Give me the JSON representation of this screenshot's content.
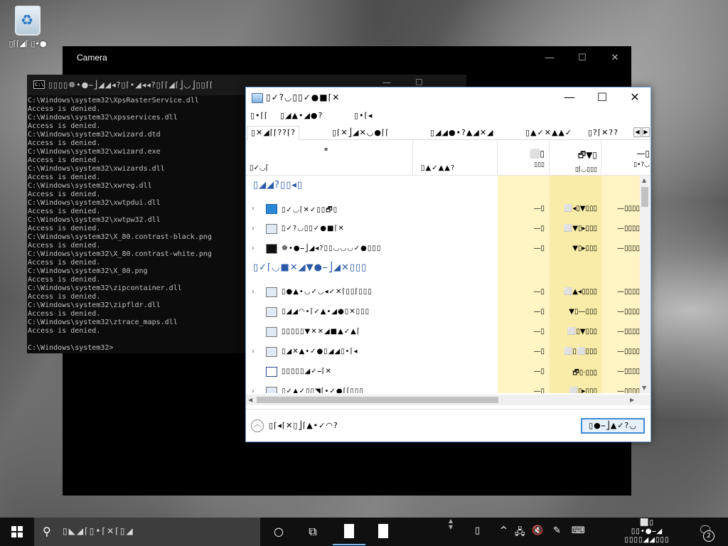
{
  "desktop": {
    "recycle_bin_label": "▯⌈⌈◢⌈ ▯•●"
  },
  "camera": {
    "title": "Camera",
    "minimize": "—",
    "maximize": "☐",
    "close": "✕"
  },
  "console": {
    "icon_text": "C:\\",
    "title": "▯▯▯▯☸•●⎯⎦◢◢◂?▯⌈•◢◂◂?▯⌈⌈◢⌈⎦◡⎦▯▯⌈⌈",
    "minimize": "—",
    "maximize": "☐",
    "lines": [
      "C:\\Windows\\system32\\XpsRasterService.dll",
      "Access is denied.",
      "C:\\Windows\\system32\\xpsservices.dll",
      "Access is denied.",
      "C:\\Windows\\system32\\xwizard.dtd",
      "Access is denied.",
      "C:\\Windows\\system32\\xwizard.exe",
      "Access is denied.",
      "C:\\Windows\\system32\\xwizards.dll",
      "Access is denied.",
      "C:\\Windows\\system32\\xwreg.dll",
      "Access is denied.",
      "C:\\Windows\\system32\\xwtpdui.dll",
      "Access is denied.",
      "C:\\Windows\\system32\\xwtpw32.dll",
      "Access is denied.",
      "C:\\Windows\\system32\\X_80.contrast-black.png",
      "Access is denied.",
      "C:\\Windows\\system32\\X_80.contrast-white.png",
      "Access is denied.",
      "C:\\Windows\\system32\\X_80.png",
      "Access is denied.",
      "C:\\Windows\\system32\\zipcontainer.dll",
      "Access is denied.",
      "C:\\Windows\\system32\\zipfldr.dll",
      "Access is denied.",
      "C:\\Windows\\system32\\ztrace_maps.dll",
      "Access is denied.",
      "",
      "C:\\Windows\\system32>"
    ]
  },
  "taskmgr": {
    "title": "▯✓?◡▯▯✓●■⌈✕",
    "minimize": "—",
    "maximize": "☐",
    "close": "✕",
    "menu": [
      "▯•⌈⌈",
      "▯◢▲•◢●?",
      "▯•⌈◂"
    ],
    "tabs": [
      "▯✕◢⌈⌈??⌈?",
      "▯⌈✕⎦◢✕◡●⌈⌈",
      "▯◢◢●•?▲◢✕◢",
      "▯▲✓✕▲▲✓",
      "▯?⌈✕??"
    ],
    "header": {
      "name": "▯✓◡⌈",
      "status": "▯▲✓▲▲?",
      "sort_arrow": "▪",
      "cpu_pct": "⬜▯",
      "cpu_label": "▯▯▯",
      "memory_pct": "🗗▼▯",
      "memory_label": "▯⌈◡▯▯▯",
      "disk_pct": "—▯",
      "disk_label": "▯•?◡"
    },
    "groups": [
      {
        "label": "▯◢◢?▯▯◂▯"
      },
      {
        "label": "▯✓⌈◡■✕◢▼●⎯⎦◢✕▯▯▯"
      }
    ],
    "rows": [
      {
        "expand": "›",
        "icon": "camera",
        "name": "▯✓◡⌈✕✓▯▯🗗▯",
        "cpu": "—▯",
        "mem": "⬜◂▯▼▯▯▯",
        "disk": "—▯▯▯▯"
      },
      {
        "expand": "›",
        "icon": "taskmgr",
        "name": "▯✓?◡▯▯✓●■⌈✕",
        "cpu": "—▯",
        "mem": "⬜▼▯▸▯▯▯",
        "disk": "—▯▯▯▯"
      },
      {
        "expand": "›",
        "icon": "console",
        "name": "☸•●⎯⎦◢◂?▯▯◡◡◡✓●▯▯▯",
        "cpu": "—▯",
        "mem": "▼▯▸▯▯▯",
        "disk": "—▯▯▯▯"
      },
      {
        "expand": "›",
        "icon": "window",
        "name": "▯●▲•◡✓◡◂✓✕⌈▯▯⌈▯▯▯",
        "cpu": "—▯",
        "mem": "⬜▲◂▯▯▯▯",
        "disk": "—▯▯▯▯"
      },
      {
        "expand": "",
        "icon": "window",
        "name": "▯◢◢◠•⌈✓▲•◢●▯✕▯▯▯",
        "cpu": "—▯",
        "mem": "▼▯—▯▯▯",
        "disk": "—▯▯▯▯"
      },
      {
        "expand": "",
        "icon": "window",
        "name": "▯▯▯▯▯▼✕✕◢■▲✓▲⌈",
        "cpu": "—▯",
        "mem": "⬜▯▼▯▯▯",
        "disk": "—▯▯▯▯"
      },
      {
        "expand": "›",
        "icon": "window",
        "name": "▯◢✕▲•✓●▯◢◢▯•⌈◂",
        "cpu": "—▯",
        "mem": "⬜▯⬜▯▯▯",
        "disk": "—▯▯▯▯"
      },
      {
        "expand": "",
        "icon": "note",
        "name": "▯▯▯▯▯◢✓⎯⌈✕",
        "cpu": "—▯",
        "mem": "🗗▯·▯▯▯",
        "disk": "—▯▯▯▯"
      },
      {
        "expand": "›",
        "icon": "window",
        "name": "▯✓▲✓▯▯◥⌈•✓●⌈⌈▯▯▯",
        "cpu": "—▯",
        "mem": "⬜▯▸▯▯▯",
        "disk": "—▯▯▯▯"
      }
    ],
    "footer": {
      "fewer_details": "▯⌈◂⌈✕▯⎦⌈▲•✓◠?",
      "end_task": "▯●⎯⎦▲✓?◡"
    }
  },
  "taskbar": {
    "search_text": "▯◣◢⌈▯•⌈✕⌈▯◢",
    "clock_line1": "⬜▯",
    "clock_line2": "▯▯•●⎯◢",
    "clock_line3": "▯▯▯▯◢◢▯▯▯",
    "notification_count": "2"
  }
}
